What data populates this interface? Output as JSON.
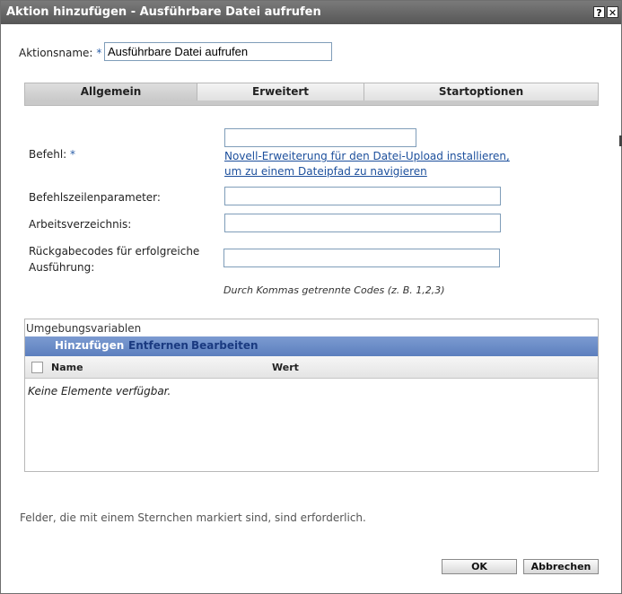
{
  "window": {
    "title": "Aktion hinzufügen - Ausführbare Datei aufrufen",
    "help_glyph": "?",
    "close_glyph": "✕"
  },
  "action_name": {
    "label": "Aktionsname:",
    "required_mark": "*",
    "value": "Ausführbare Datei aufrufen"
  },
  "tabs": [
    {
      "label": "Allgemein",
      "active": true
    },
    {
      "label": "Erweitert",
      "active": false
    },
    {
      "label": "Startoptionen",
      "active": false
    }
  ],
  "form": {
    "command": {
      "label": "Befehl:",
      "required_mark": "*",
      "value": "",
      "link_line1": "Novell-Erweiterung für den Datei-Upload installieren,",
      "link_line2": "um zu einem Dateipfad zu navigieren"
    },
    "params": {
      "label": "Befehlszeilenparameter:",
      "value": ""
    },
    "workdir": {
      "label": "Arbeitsverzeichnis:",
      "value": ""
    },
    "return_codes": {
      "label_line1": "Rückgabecodes für erfolgreiche",
      "label_line2": "Ausführung:",
      "value": "",
      "hint": "Durch Kommas getrennte Codes (z. B. 1,2,3)"
    }
  },
  "env": {
    "title": "Umgebungsvariablen",
    "toolbar": {
      "add": "Hinzufügen",
      "remove": "Entfernen",
      "edit": "Bearbeiten"
    },
    "columns": {
      "name": "Name",
      "value": "Wert"
    },
    "empty_text": "Keine Elemente verfügbar."
  },
  "footer": {
    "note": "Felder, die mit einem Sternchen markiert sind, sind erforderlich.",
    "ok": "OK",
    "cancel": "Abbrechen"
  }
}
